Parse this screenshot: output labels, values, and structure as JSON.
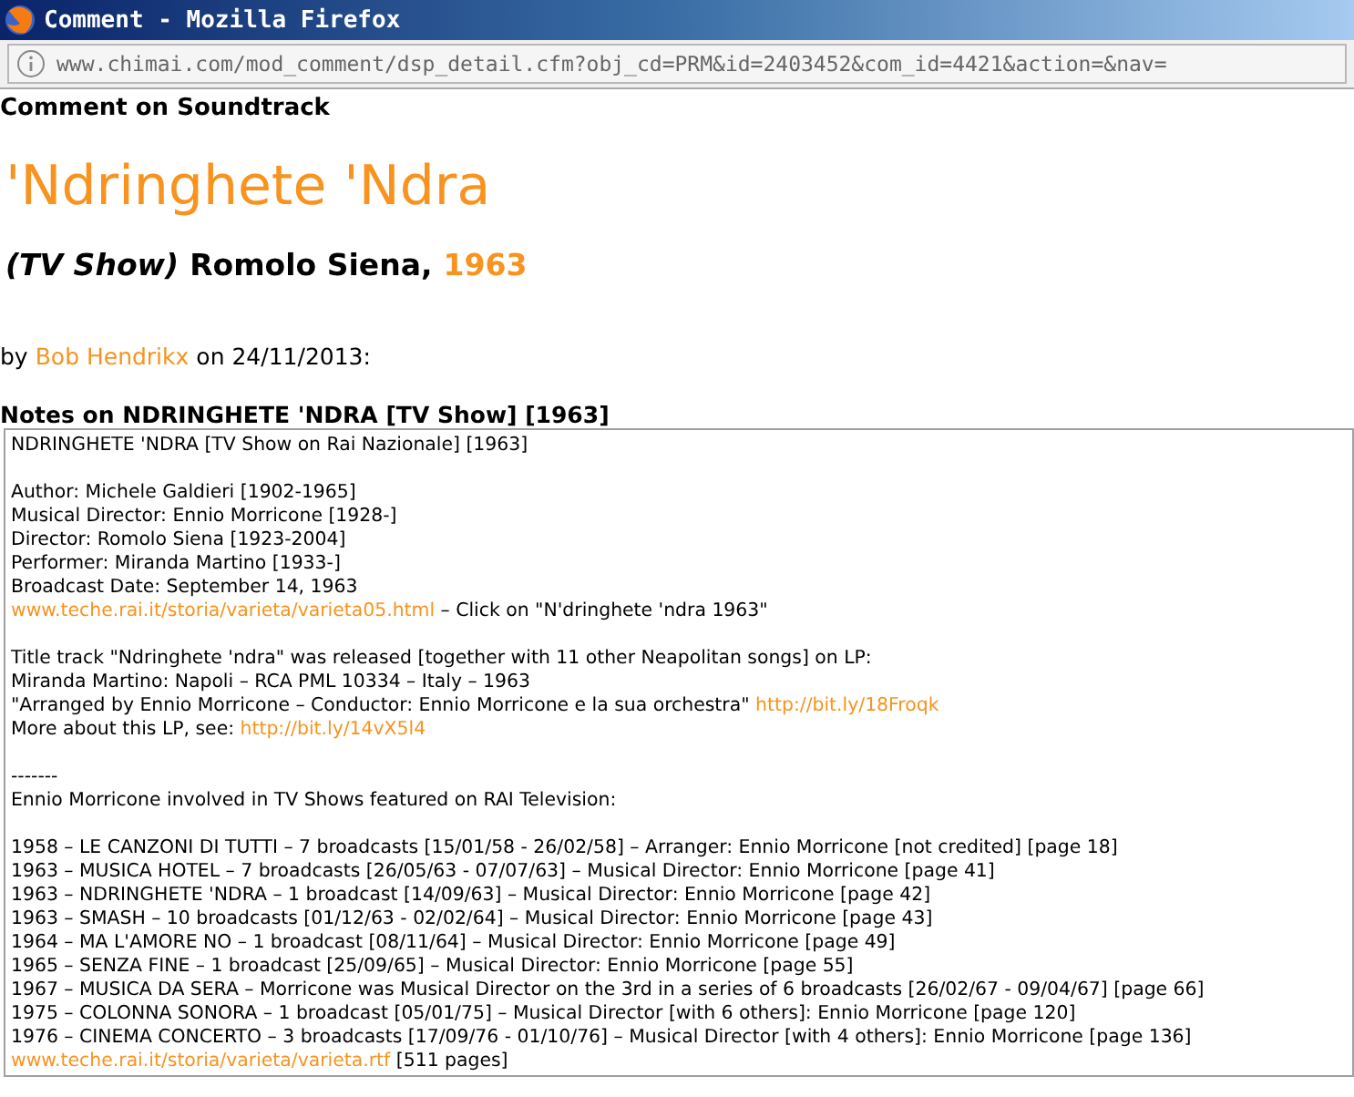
{
  "window": {
    "title": "Comment - Mozilla Firefox"
  },
  "address_bar": {
    "url": "www.chimai.com/mod_comment/dsp_detail.cfm?obj_cd=PRM&id=2403452&com_id=4421&action=&nav="
  },
  "page": {
    "section": "Comment on Soundtrack",
    "title": "'Ndringhete 'Ndra",
    "type": "(TV Show)",
    "director": "Romolo Siena,",
    "year": "1963",
    "byline": {
      "prefix": "by",
      "author": "Bob Hendrikx",
      "suffix": "on 24/11/2013:"
    }
  },
  "notes": {
    "heading": "Notes on NDRINGHETE 'NDRA [TV Show] [1963]",
    "paragraphs": [
      [
        [
          {
            "kind": "text",
            "text": "NDRINGHETE 'NDRA [TV Show on Rai Nazionale] [1963]"
          }
        ]
      ],
      [
        [
          {
            "kind": "text",
            "text": "Author: Michele Galdieri [1902-1965]"
          }
        ],
        [
          {
            "kind": "text",
            "text": "Musical Director: Ennio Morricone [1928-]"
          }
        ],
        [
          {
            "kind": "text",
            "text": "Director: Romolo Siena [1923-2004]"
          }
        ],
        [
          {
            "kind": "text",
            "text": "Performer: Miranda Martino [1933-]"
          }
        ],
        [
          {
            "kind": "text",
            "text": "Broadcast Date: September 14, 1963"
          }
        ],
        [
          {
            "kind": "link",
            "text": "www.teche.rai.it/storia/varieta/varieta05.html"
          },
          {
            "kind": "text",
            "text": " – Click on \"N'dringhete 'ndra 1963\""
          }
        ]
      ],
      [
        [
          {
            "kind": "text",
            "text": "Title track \"Ndringhete 'ndra\" was released [together with 11 other Neapolitan songs] on LP:"
          }
        ],
        [
          {
            "kind": "text",
            "text": "Miranda Martino: Napoli – RCA PML 10334 – Italy – 1963"
          }
        ],
        [
          {
            "kind": "text",
            "text": "\"Arranged by Ennio Morricone – Conductor: Ennio Morricone e la sua orchestra\" "
          },
          {
            "kind": "link",
            "text": "http://bit.ly/18Froqk"
          }
        ],
        [
          {
            "kind": "text",
            "text": "More about this LP, see: "
          },
          {
            "kind": "link",
            "text": "http://bit.ly/14vX5l4"
          }
        ]
      ],
      [
        [
          {
            "kind": "text",
            "text": "-------"
          }
        ],
        [
          {
            "kind": "text",
            "text": "Ennio Morricone involved in TV Shows featured on RAI Television:"
          }
        ]
      ],
      [
        [
          {
            "kind": "text",
            "text": "1958 – LE CANZONI DI TUTTI – 7 broadcasts [15/01/58 - 26/02/58] – Arranger: Ennio Morricone [not credited] [page 18]"
          }
        ],
        [
          {
            "kind": "text",
            "text": "1963 – MUSICA HOTEL – 7 broadcasts [26/05/63 - 07/07/63] – Musical Director: Ennio Morricone [page 41]"
          }
        ],
        [
          {
            "kind": "text",
            "text": "1963 – NDRINGHETE 'NDRA – 1 broadcast [14/09/63] – Musical Director: Ennio Morricone [page 42]"
          }
        ],
        [
          {
            "kind": "text",
            "text": "1963 – SMASH – 10 broadcasts [01/12/63 - 02/02/64] – Musical Director: Ennio Morricone [page 43]"
          }
        ],
        [
          {
            "kind": "text",
            "text": "1964 – MA L'AMORE NO – 1 broadcast [08/11/64] – Musical Director: Ennio Morricone [page 49]"
          }
        ],
        [
          {
            "kind": "text",
            "text": "1965 – SENZA FINE – 1 broadcast [25/09/65] – Musical Director: Ennio Morricone [page 55]"
          }
        ],
        [
          {
            "kind": "text",
            "text": "1967 – MUSICA DA SERA – Morricone was Musical Director on the 3rd in a series of 6 broadcasts [26/02/67 - 09/04/67] [page 66]"
          }
        ],
        [
          {
            "kind": "text",
            "text": "1975 – COLONNA SONORA – 1 broadcast [05/01/75] – Musical Director [with 6 others]: Ennio Morricone [page 120]"
          }
        ],
        [
          {
            "kind": "text",
            "text": "1976 – CINEMA CONCERTO – 3 broadcasts [17/09/76 - 01/10/76] – Musical Director [with 4 others]: Ennio Morricone [page 136]"
          }
        ],
        [
          {
            "kind": "link",
            "text": "www.teche.rai.it/storia/varieta/varieta.rtf"
          },
          {
            "kind": "text",
            "text": " [511 pages]"
          }
        ]
      ]
    ]
  }
}
